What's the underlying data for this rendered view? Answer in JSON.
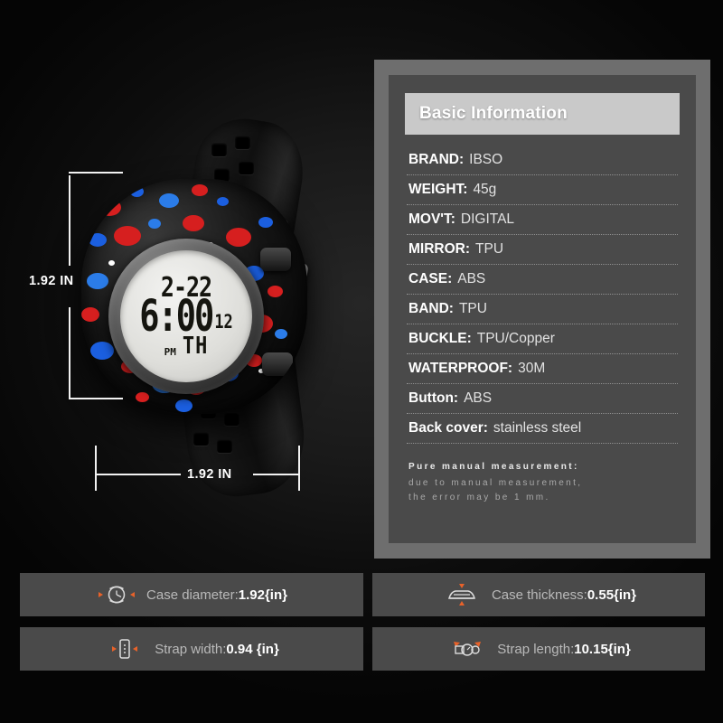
{
  "product": {
    "display": {
      "top_line": "2-22",
      "time": "6:00",
      "sub": "12",
      "meridiem": "PM",
      "weekday": "TH"
    }
  },
  "dimensions": {
    "vertical_label": "1.92 IN",
    "horizontal_label": "1.92 IN"
  },
  "spec_panel": {
    "header": "Basic Information",
    "rows": [
      {
        "key": "BRAND:",
        "value": "IBSO"
      },
      {
        "key": "WEIGHT:",
        "value": "45g"
      },
      {
        "key": "MOV'T:",
        "value": "DIGITAL"
      },
      {
        "key": "MIRROR:",
        "value": "TPU"
      },
      {
        "key": "CASE:",
        "value": "ABS"
      },
      {
        "key": "BAND:",
        "value": "TPU"
      },
      {
        "key": "BUCKLE:",
        "value": "TPU/Copper"
      },
      {
        "key": "WATERPROOF:",
        "value": "30M"
      },
      {
        "key": "Button:",
        "value": "ABS"
      },
      {
        "key": "Back cover:",
        "value": "stainless steel"
      }
    ],
    "note": {
      "line1": "Pure manual measurement:",
      "line2": "due to manual measurement,",
      "line3": "the error may be 1 mm."
    }
  },
  "info_bars": [
    {
      "icon": "watch-face-icon",
      "label": "Case diameter:",
      "value": "1.92{in}"
    },
    {
      "icon": "case-side-icon",
      "label": "Case thickness:",
      "value": "0.55{in}"
    },
    {
      "icon": "strap-width-icon",
      "label": "Strap width:",
      "value": "0.94 {in}"
    },
    {
      "icon": "strap-length-icon",
      "label": "Strap length:",
      "value": "10.15{in}"
    }
  ],
  "colors": {
    "background": "#0d0d0d",
    "panel_frame": "#6e6e6e",
    "panel_inner": "#4a4a4a",
    "panel_header": "#c9c9c9",
    "accent_orange": "#e8622a",
    "splatter_red": "#d61f1f",
    "splatter_blue": "#1b5fe0"
  }
}
